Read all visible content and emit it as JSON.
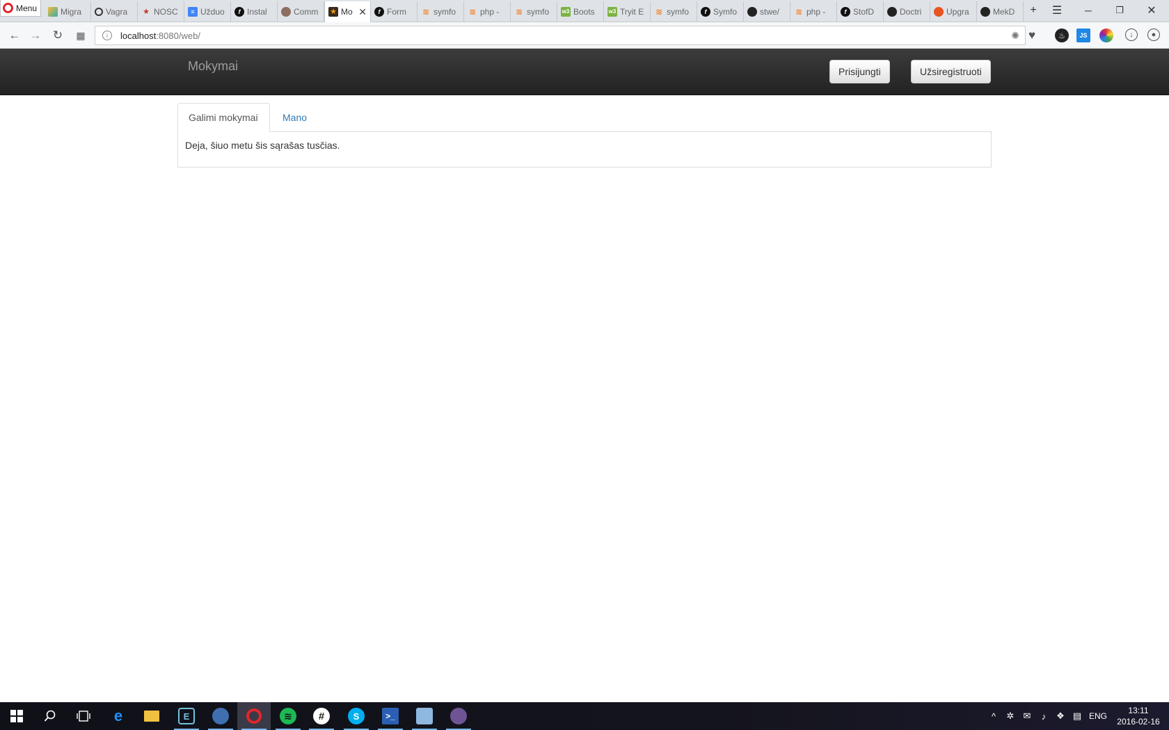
{
  "browser": {
    "menu_label": "Menu",
    "tabs": [
      {
        "label": "Migra",
        "icon": "yii-icon"
      },
      {
        "label": "Vagra",
        "icon": "vagrant-icon"
      },
      {
        "label": "NOSC",
        "icon": "nosql-icon"
      },
      {
        "label": "Užduo",
        "icon": "google-docs-icon"
      },
      {
        "label": "Instal",
        "icon": "symfony-icon"
      },
      {
        "label": "Comm",
        "icon": "community-icon"
      },
      {
        "label": "Mo",
        "icon": "mokymai-icon",
        "active": true
      },
      {
        "label": "Form",
        "icon": "symfony-icon"
      },
      {
        "label": "symfo",
        "icon": "stackoverflow-icon"
      },
      {
        "label": "php -",
        "icon": "stackoverflow-icon"
      },
      {
        "label": "symfo",
        "icon": "stackoverflow-icon"
      },
      {
        "label": "Boots",
        "icon": "bootstrap-icon"
      },
      {
        "label": "Tryit E",
        "icon": "w3schools-icon"
      },
      {
        "label": "symfo",
        "icon": "stackoverflow-icon"
      },
      {
        "label": "Symfo",
        "icon": "symfony-icon"
      },
      {
        "label": "stwe/",
        "icon": "github-icon"
      },
      {
        "label": "php -",
        "icon": "stackoverflow-icon"
      },
      {
        "label": "StofD",
        "icon": "symfony-icon"
      },
      {
        "label": "Doctri",
        "icon": "github-icon"
      },
      {
        "label": "Upgra",
        "icon": "ubuntu-icon"
      },
      {
        "label": "MekD",
        "icon": "github-icon"
      }
    ],
    "address": {
      "host": "localhost",
      "rest": ":8080/web/"
    }
  },
  "page": {
    "brand": "Mokymai",
    "login_label": "Prisijungti",
    "register_label": "Užsiregistruoti",
    "tab_available": "Galimi mokymai",
    "tab_mine": "Mano",
    "empty_message": "Deja, šiuo metu šis sąrašas tusčias."
  },
  "taskbar": {
    "language": "ENG",
    "time": "13:11",
    "date": "2016-02-16"
  },
  "colors": {
    "link": "#337ab7",
    "navbar": "#222222",
    "opera_red": "#e0262b"
  }
}
